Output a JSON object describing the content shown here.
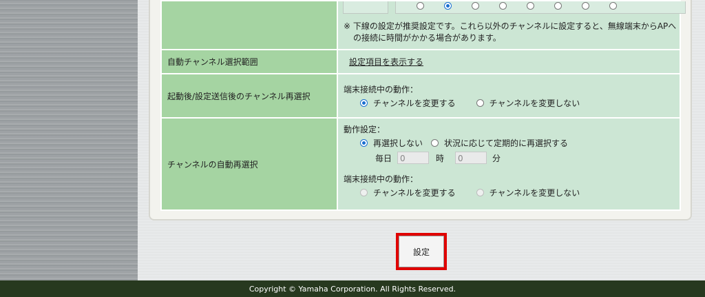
{
  "channel_notice": "※ 下線の設定が推奨設定です。これら以外のチャンネルに設定すると、無線端末からAPへの接続に時間がかかる場合があります。",
  "channel_notice_line1": "※ 下線の設定が推奨設定です。これら以外のチャンネルに設定すると、無線端末からAPへ",
  "channel_notice_line2": "の接続に時間がかかる場合があります。",
  "auto_channel_range": {
    "label": "自動チャンネル選択範囲",
    "link": "設定項目を表示する"
  },
  "reselect_after_start": {
    "label": "起動後/設定送信後のチャンネル再選択",
    "heading": "端末接続中の動作：",
    "options": [
      "チャンネルを変更する",
      "チャンネルを変更しない"
    ],
    "selected": 0
  },
  "auto_reselect": {
    "label": "チャンネルの自動再選択",
    "action_heading": "動作設定：",
    "action_options": [
      "再選択しない",
      "状況に応じて定期的に再選択する"
    ],
    "action_selected": 0,
    "daily_label": "毎日",
    "hour_value": "0",
    "hour_label": "時",
    "minute_value": "0",
    "minute_label": "分",
    "connected_heading": "端末接続中の動作：",
    "connected_options": [
      "チャンネルを変更する",
      "チャンネルを変更しない"
    ]
  },
  "submit_label": "設定",
  "footer": "Copyright © Yamaha Corporation. All Rights Reserved.",
  "colors": {
    "label_bg": "#a5d4a2",
    "value_bg": "#cce6d4",
    "footer_bg": "#27391f",
    "highlight": "#e00000",
    "radio_selected": "#1a6fd1"
  }
}
